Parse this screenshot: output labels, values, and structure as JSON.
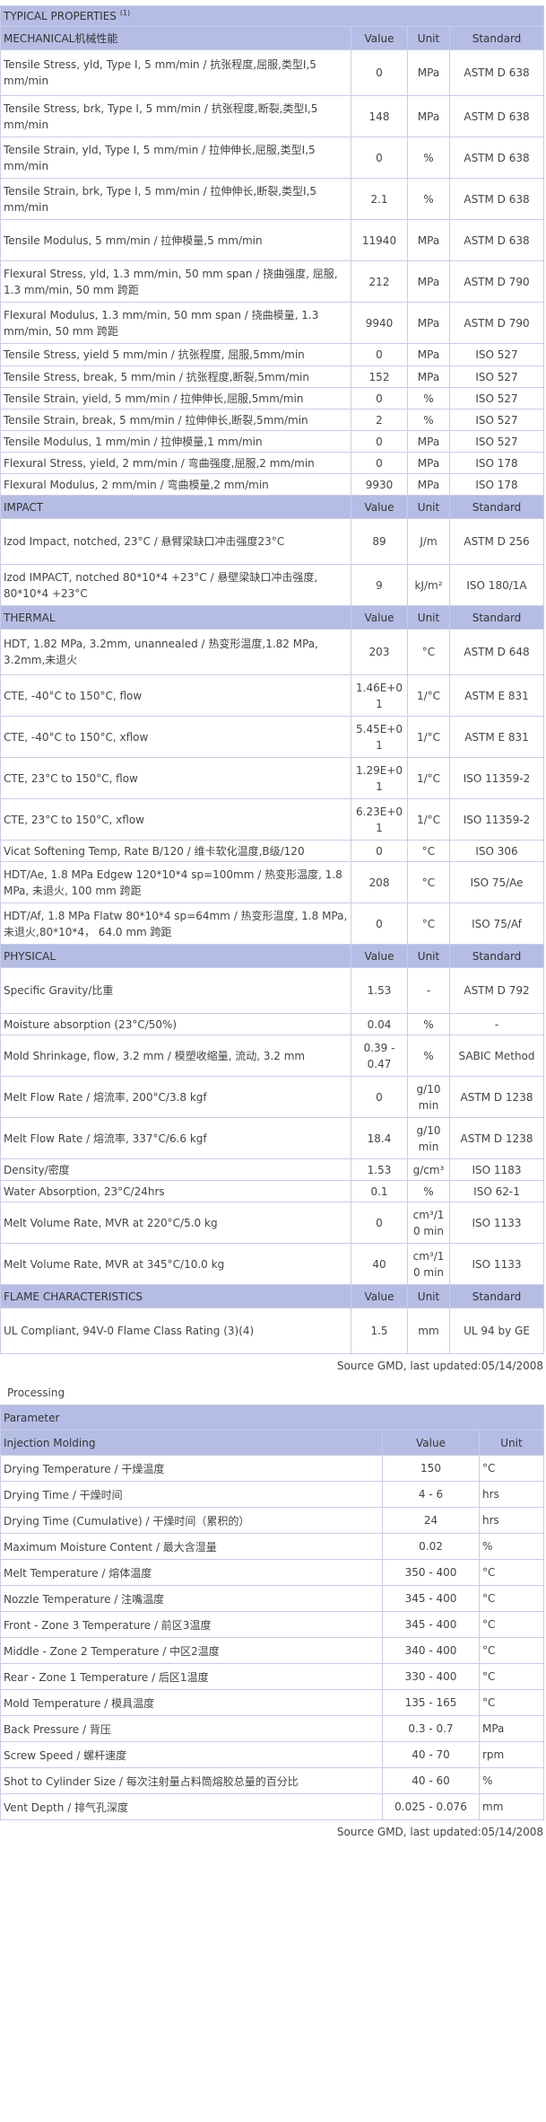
{
  "typical": {
    "title": "TYPICAL PROPERTIES",
    "title_sup": "(1)",
    "sections": [
      {
        "name": "MECHANICAL机械性能",
        "headers": [
          "Value",
          "Unit",
          "Standard"
        ],
        "rows": [
          {
            "p": "Tensile Stress, yld, Type I, 5 mm/min / 抗张程度,屈服,类型I,5 mm/min",
            "v": "0",
            "u": "MPa",
            "s": "ASTM D 638",
            "h": 51
          },
          {
            "p": "Tensile Stress, brk, Type I, 5 mm/min / 抗张程度,断裂,类型I,5 mm/min",
            "v": "148",
            "u": "MPa",
            "s": "ASTM D 638",
            "h": 46
          },
          {
            "p": "Tensile Strain, yld, Type I, 5 mm/min / 拉伸伸长,屈服,类型I,5 mm/min",
            "v": "0",
            "u": "%",
            "s": "ASTM D 638",
            "h": 46
          },
          {
            "p": "Tensile Strain, brk, Type I, 5 mm/min / 拉伸伸长,断裂,类型I,5 mm/min",
            "v": "2.1",
            "u": "%",
            "s": "ASTM D 638",
            "h": 46
          },
          {
            "p": "Tensile Modulus, 5 mm/min / 拉伸模量,5 mm/min",
            "v": "11940",
            "u": "MPa",
            "s": "ASTM D 638",
            "h": 46
          },
          {
            "p": "Flexural Stress, yld, 1.3 mm/min, 50 mm span / 挠曲强度, 屈服, 1.3 mm/min, 50 mm 跨距",
            "v": "212",
            "u": "MPa",
            "s": "ASTM D 790",
            "h": 46
          },
          {
            "p": "Flexural Modulus, 1.3 mm/min, 50 mm span / 挠曲模量, 1.3 mm/min, 50 mm 跨距",
            "v": "9940",
            "u": "MPa",
            "s": "ASTM D 790",
            "h": 46
          },
          {
            "p": "Tensile Stress, yield 5 mm/min / 抗张程度, 屈服,5mm/min",
            "v": "0",
            "u": "MPa",
            "s": "ISO 527",
            "h": 25
          },
          {
            "p": "Tensile Stress, break, 5 mm/min / 抗张程度,断裂,5mm/min",
            "v": "152",
            "u": "MPa",
            "s": "ISO 527",
            "h": 24
          },
          {
            "p": "Tensile Strain, yield, 5 mm/min / 拉伸伸长,屈服,5mm/min",
            "v": "0",
            "u": "%",
            "s": "ISO 527",
            "h": 24
          },
          {
            "p": "Tensile Strain, break, 5 mm/min / 拉伸伸长,断裂,5mm/min",
            "v": "2",
            "u": "%",
            "s": "ISO 527",
            "h": 24
          },
          {
            "p": "Tensile Modulus, 1 mm/min / 拉伸模量,1 mm/min",
            "v": "0",
            "u": "MPa",
            "s": "ISO 527",
            "h": 24
          },
          {
            "p": "Flexural Stress, yield, 2 mm/min / 弯曲强度,屈服,2 mm/min",
            "v": "0",
            "u": "MPa",
            "s": "ISO 178",
            "h": 24
          },
          {
            "p": "Flexural Modulus, 2 mm/min / 弯曲模量,2 mm/min",
            "v": "9930",
            "u": "MPa",
            "s": "ISO 178",
            "h": 24
          }
        ]
      },
      {
        "name": "IMPACT",
        "headers": [
          "Value",
          "Unit",
          "Standard"
        ],
        "rows": [
          {
            "p": "Izod Impact, notched, 23°C / 悬臂梁缺口冲击强度23°C",
            "v": "89",
            "u": "J/m",
            "s": "ASTM D 256",
            "h": 51
          },
          {
            "p": "Izod IMPACT, notched 80*10*4 +23°C / 悬壁梁缺口冲击强度, 80*10*4 +23°C",
            "v": "9",
            "u": "kJ/m²",
            "s": "ISO 180/1A",
            "h": 46
          }
        ]
      },
      {
        "name": "THERMAL",
        "headers": [
          "Value",
          "Unit",
          "Standard"
        ],
        "rows": [
          {
            "p": "HDT, 1.82 MPa, 3.2mm, unannealed / 热变形温度,1.82 MPa, 3.2mm,未退火",
            "v": "203",
            "u": "°C",
            "s": "ASTM D 648",
            "h": 51
          },
          {
            "p": "CTE, -40°C to 150°C, flow",
            "v": "1.46E+01",
            "u": "1/°C",
            "s": "ASTM E 831",
            "h": 46
          },
          {
            "p": "CTE, -40°C to 150°C, xflow",
            "v": "5.45E+01",
            "u": "1/°C",
            "s": "ASTM E 831",
            "h": 46
          },
          {
            "p": "CTE, 23°C to 150°C, flow",
            "v": "1.29E+01",
            "u": "1/°C",
            "s": "ISO 11359-2",
            "h": 46
          },
          {
            "p": "CTE, 23°C to 150°C, xflow",
            "v": "6.23E+01",
            "u": "1/°C",
            "s": "ISO 11359-2",
            "h": 46
          },
          {
            "p": "Vicat Softening Temp, Rate B/120 / 维卡软化温度,B级/120",
            "v": "0",
            "u": "°C",
            "s": "ISO 306",
            "h": 24
          },
          {
            "p": "HDT/Ae, 1.8 MPa Edgew 120*10*4 sp=100mm / 热变形温度, 1.8 MPa, 未退火, 100 mm 跨距",
            "v": "208",
            "u": "°C",
            "s": "ISO 75/Ae",
            "h": 46
          },
          {
            "p": "HDT/Af, 1.8 MPa Flatw 80*10*4 sp=64mm / 热变形温度, 1.8 MPa, 未退火,80*10*4， 64.0 mm 跨距",
            "v": "0",
            "u": "°C",
            "s": "ISO 75/Af",
            "h": 46
          }
        ]
      },
      {
        "name": "PHYSICAL",
        "headers": [
          "Value",
          "Unit",
          "Standard"
        ],
        "rows": [
          {
            "p": "Specific Gravity/比重",
            "v": "1.53",
            "u": "-",
            "s": "ASTM D 792",
            "h": 51
          },
          {
            "p": "Moisture absorption (23°C/50%)",
            "v": "0.04",
            "u": "%",
            "s": "-",
            "h": 24
          },
          {
            "p": "Mold Shrinkage, flow, 3.2 mm / 模塑收缩量, 流动, 3.2 mm",
            "v": "0.39 - 0.47",
            "u": "%",
            "s": "SABIC Method",
            "h": 46
          },
          {
            "p": "Melt Flow Rate / 熔流率, 200°C/3.8 kgf",
            "v": "0",
            "u": "g/10 min",
            "s": "ASTM D 1238",
            "h": 46
          },
          {
            "p": "Melt Flow Rate / 熔流率, 337°C/6.6 kgf",
            "v": "18.4",
            "u": "g/10 min",
            "s": "ASTM D 1238",
            "h": 46
          },
          {
            "p": "Density/密度",
            "v": "1.53",
            "u": "g/cm³",
            "s": "ISO 1183",
            "h": 24
          },
          {
            "p": "Water Absorption, 23°C/24hrs",
            "v": "0.1",
            "u": "%",
            "s": "ISO 62-1",
            "h": 24
          },
          {
            "p": "Melt Volume Rate, MVR at 220°C/5.0 kg",
            "v": "0",
            "u": "cm³/10 min",
            "s": "ISO 1133",
            "h": 46
          },
          {
            "p": "Melt Volume Rate, MVR at 345°C/10.0 kg",
            "v": "40",
            "u": "cm³/10 min",
            "s": "ISO 1133",
            "h": 46
          }
        ]
      },
      {
        "name": "FLAME CHARACTERISTICS",
        "headers": [
          "Value",
          "Unit",
          "Standard"
        ],
        "rows": [
          {
            "p": "UL Compliant, 94V-0 Flame Class Rating (3)(4)",
            "v": "1.5",
            "u": "mm",
            "s": "UL 94 by GE",
            "h": 51
          }
        ]
      }
    ],
    "source": "Source GMD, last updated:05/14/2008"
  },
  "processing": {
    "title": "Processing",
    "parameter_header": "Parameter",
    "section_name": "Injection Molding",
    "headers": [
      "Value",
      "Unit"
    ],
    "rows": [
      {
        "p": "Drying Temperature / 干燥温度",
        "v": "150",
        "u": "°C"
      },
      {
        "p": "Drying Time / 干燥时间",
        "v": "4 - 6",
        "u": "hrs"
      },
      {
        "p": "Drying Time (Cumulative) / 干燥时间（累积的）",
        "v": "24",
        "u": "hrs"
      },
      {
        "p": "Maximum Moisture Content / 最大含湿量",
        "v": "0.02",
        "u": "%"
      },
      {
        "p": "Melt Temperature / 熔体温度",
        "v": "350 - 400",
        "u": "°C"
      },
      {
        "p": "Nozzle Temperature / 注嘴温度",
        "v": "345 - 400",
        "u": "°C"
      },
      {
        "p": "Front - Zone 3 Temperature / 前区3温度",
        "v": "345 - 400",
        "u": "°C"
      },
      {
        "p": "Middle - Zone 2 Temperature / 中区2温度",
        "v": "340 - 400",
        "u": "°C"
      },
      {
        "p": "Rear - Zone 1 Temperature / 后区1温度",
        "v": "330 - 400",
        "u": "°C"
      },
      {
        "p": "Mold Temperature / 模具温度",
        "v": "135 - 165",
        "u": "°C"
      },
      {
        "p": "Back Pressure / 背压",
        "v": "0.3 - 0.7",
        "u": "MPa"
      },
      {
        "p": "Screw Speed / 螺杆速度",
        "v": "40 - 70",
        "u": "rpm"
      },
      {
        "p": "Shot to Cylinder Size / 每次注射量占料筒熔胶总量的百分比",
        "v": "40 - 60",
        "u": "%"
      },
      {
        "p": "Vent Depth / 排气孔深度",
        "v": "0.025 - 0.076",
        "u": "mm"
      }
    ],
    "source": "Source GMD, last updated:05/14/2008"
  }
}
